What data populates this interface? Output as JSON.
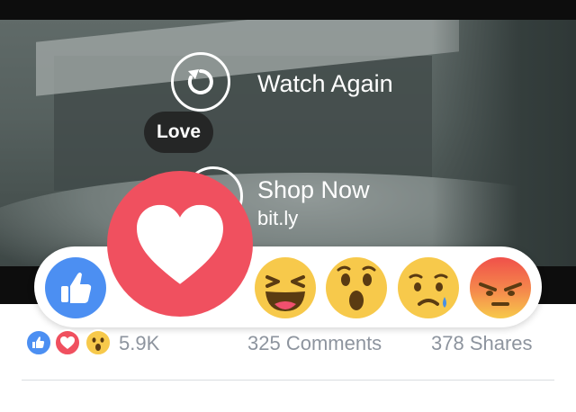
{
  "video": {
    "watch_again_label": "Watch Again",
    "shop_now_label": "Shop Now",
    "shop_now_domain": "bit.ly"
  },
  "reaction_tooltip": "Love",
  "reactions": [
    {
      "name": "like",
      "color": "#4c8ff2"
    },
    {
      "name": "love",
      "color": "#f0505f"
    },
    {
      "name": "haha",
      "color": "#f7c94b"
    },
    {
      "name": "wow",
      "color": "#f7c94b"
    },
    {
      "name": "sad",
      "color": "#f7c94b"
    },
    {
      "name": "angry",
      "color": "#f0764a"
    }
  ],
  "stats": {
    "reactions_count": "5.9K",
    "comments": "325 Comments",
    "shares": "378 Shares"
  }
}
